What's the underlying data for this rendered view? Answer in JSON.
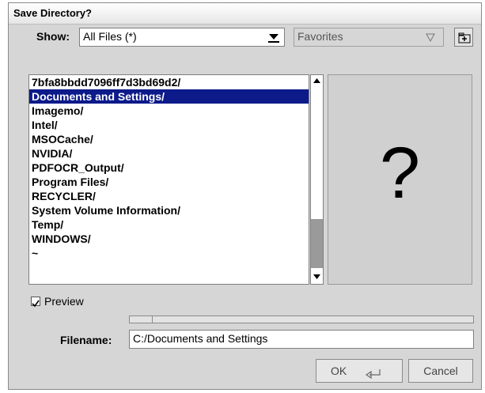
{
  "dialog": {
    "title": "Save Directory?"
  },
  "show": {
    "label": "Show:",
    "value": "All Files (*)"
  },
  "favorites": {
    "label": "Favorites"
  },
  "files": [
    "7bfa8bbdd7096ff7d3bd69d2/",
    "Documents and Settings/",
    "Imagemo/",
    "Intel/",
    "MSOCache/",
    "NVIDIA/",
    "PDFOCR_Output/",
    "Program Files/",
    "RECYCLER/",
    "System Volume Information/",
    "Temp/",
    "WINDOWS/",
    "~"
  ],
  "preview_panel": {
    "placeholder": "?"
  },
  "preview_option": {
    "label": "Preview",
    "checked": true
  },
  "filename": {
    "label": "Filename:",
    "value": "C:/Documents and Settings"
  },
  "buttons": {
    "ok": "OK",
    "cancel": "Cancel"
  },
  "colors": {
    "selection": "#0c1a8a",
    "dialog_bg": "#d6d6d6"
  }
}
